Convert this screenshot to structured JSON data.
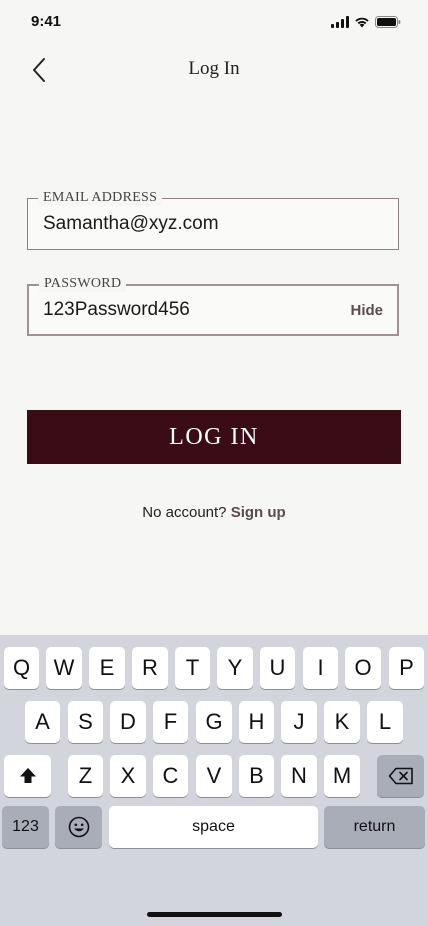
{
  "status": {
    "time": "9:41"
  },
  "nav": {
    "title": "Log In"
  },
  "form": {
    "email_label": "EMAIL ADDRESS",
    "email_value": "Samantha@xyz.com",
    "password_label": "PASSWORD",
    "password_value": "123Password456",
    "hide_label": "Hide",
    "login_label": "LOG IN",
    "signup_prompt": "No account?",
    "signup_link": "Sign up"
  },
  "keyboard": {
    "row1": [
      "Q",
      "W",
      "E",
      "R",
      "T",
      "Y",
      "U",
      "I",
      "O",
      "P"
    ],
    "row2": [
      "A",
      "S",
      "D",
      "F",
      "G",
      "H",
      "J",
      "K",
      "L"
    ],
    "row3": [
      "Z",
      "X",
      "C",
      "V",
      "B",
      "N",
      "M"
    ],
    "numbers_label": "123",
    "space_label": "space",
    "return_label": "return",
    "shift_icon": "shift-icon",
    "delete_icon": "backspace-icon",
    "emoji_icon": "emoji-icon"
  },
  "colors": {
    "background": "#F6F6F4",
    "primary_button": "#3A0D16",
    "accent_text": "#5A4B50",
    "keyboard_bg": "#D3D5DC"
  }
}
